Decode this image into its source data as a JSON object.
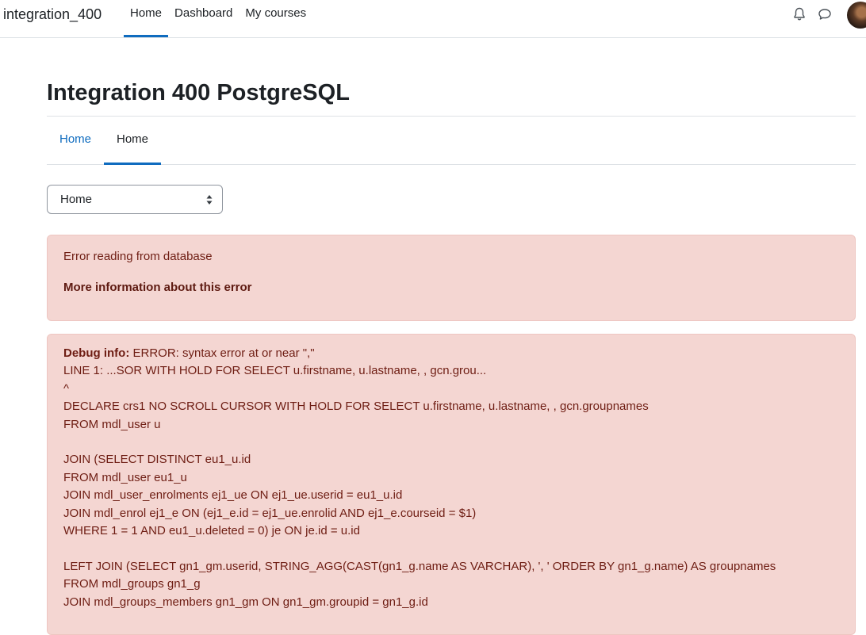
{
  "navbar": {
    "brand": "integration_400",
    "items": [
      {
        "label": "Home",
        "active": true
      },
      {
        "label": "Dashboard",
        "active": false
      },
      {
        "label": "My courses",
        "active": false
      }
    ],
    "icons": [
      "bell-icon",
      "chat-icon"
    ]
  },
  "page": {
    "title": "Integration 400 PostgreSQL",
    "tabs": [
      {
        "label": "Home",
        "active": false
      },
      {
        "label": "Home",
        "active": true
      }
    ],
    "select": {
      "value": "Home"
    }
  },
  "error": {
    "message": "Error reading from database",
    "more_info": "More information about this error"
  },
  "debug": {
    "label": "Debug info:",
    "first_line": " ERROR: syntax error at or near \",\"",
    "lines": [
      "LINE 1: ...SOR WITH HOLD FOR SELECT u.firstname, u.lastname, , gcn.grou...",
      "^",
      "DECLARE crs1 NO SCROLL CURSOR WITH HOLD FOR SELECT u.firstname, u.lastname, , gcn.groupnames",
      "FROM mdl_user u",
      "",
      "JOIN (SELECT DISTINCT eu1_u.id",
      "FROM mdl_user eu1_u",
      "JOIN mdl_user_enrolments ej1_ue ON ej1_ue.userid = eu1_u.id",
      "JOIN mdl_enrol ej1_e ON (ej1_e.id = ej1_ue.enrolid AND ej1_e.courseid = $1)",
      "WHERE 1 = 1 AND eu1_u.deleted = 0) je ON je.id = u.id",
      "",
      "LEFT JOIN (SELECT gn1_gm.userid, STRING_AGG(CAST(gn1_g.name AS VARCHAR), ', ' ORDER BY gn1_g.name) AS groupnames",
      "FROM mdl_groups gn1_g",
      "JOIN mdl_groups_members gn1_gm ON gn1_gm.groupid = gn1_g.id"
    ]
  }
}
